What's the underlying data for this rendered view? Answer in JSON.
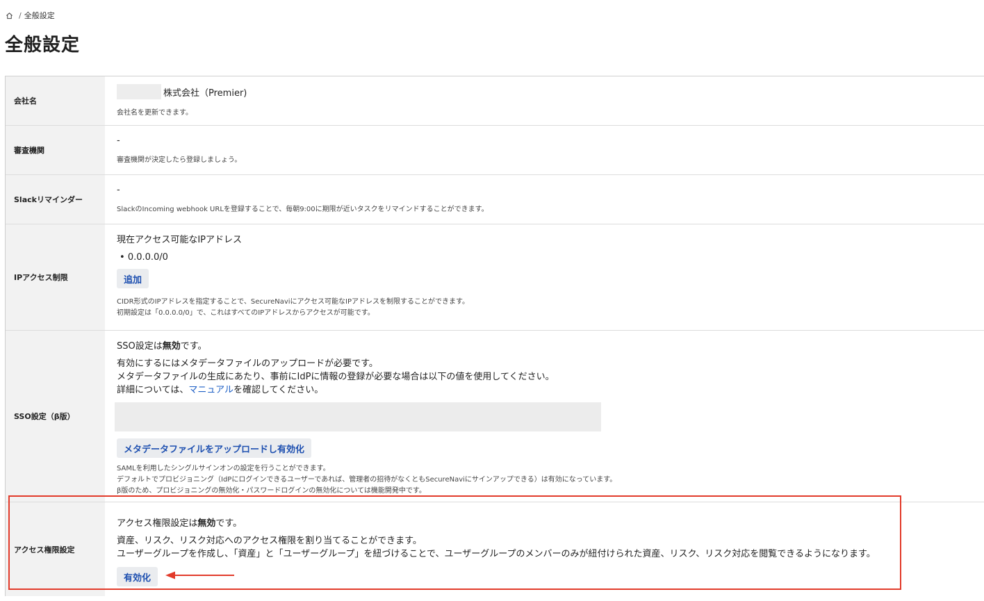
{
  "breadcrumb": {
    "separator": "/",
    "current": "全般設定"
  },
  "page": {
    "title": "全般設定"
  },
  "company": {
    "label": "会社名",
    "value": "株式会社（Premier)",
    "description": "会社名を更新できます。"
  },
  "review": {
    "label": "審査機関",
    "value": "-",
    "description": "審査機関が決定したら登録しましょう。"
  },
  "slack": {
    "label": "Slackリマインダー",
    "value": "-",
    "description": "SlackのIncoming webhook URLを登録することで、毎朝9:00に期限が近いタスクをリマインドすることができます。"
  },
  "ip": {
    "label": "IPアクセス制限",
    "heading": "現在アクセス可能なIPアドレス",
    "addresses": [
      "0.0.0.0/0"
    ],
    "add_button": "追加",
    "desc1": "CIDR形式のIPアドレスを指定することで、SecureNaviにアクセス可能なIPアドレスを制限することができます。",
    "desc2": "初期設定は「0.0.0.0/0」で、これはすべてのIPアドレスからアクセスが可能です。"
  },
  "sso": {
    "label": "SSO設定（β版）",
    "status_prefix": "SSO設定は",
    "status_value": "無効",
    "status_suffix": "です。",
    "line1": "有効にするにはメタデータファイルのアップロードが必要です。",
    "line2": "メタデータファイルの生成にあたり、事前にIdPに情報の登録が必要な場合は以下の値を使用してください。",
    "line3_prefix": "詳細については、",
    "line3_link": "マニュアル",
    "line3_suffix": "を確認してください。",
    "upload_button": "メタデータファイルをアップロードし有効化",
    "desc1": "SAMLを利用したシングルサインオンの設定を行うことができます。",
    "desc2": "デフォルトでプロビジョニング（IdPにログインできるユーザーであれば、管理者の招待がなくともSecureNaviにサインアップできる）は有効になっています。",
    "desc3": "β版のため、プロビジョニングの無効化・パスワードログインの無効化については機能開発中です。"
  },
  "access": {
    "label": "アクセス権限設定",
    "status_prefix": "アクセス権限設定は",
    "status_value": "無効",
    "status_suffix": "です。",
    "line1": "資産、リスク、リスク対応へのアクセス権限を割り当てることができます。",
    "line2": "ユーザーグループを作成し、「資産」と「ユーザーグループ」を紐づけることで、ユーザーグループのメンバーのみが紐付けられた資産、リスク、リスク対応を閲覧できるようになります。",
    "enable_button": "有効化"
  },
  "colors": {
    "highlight": "#e23a2a",
    "link": "#1d5fc5",
    "button_text": "#1d4fb0"
  }
}
